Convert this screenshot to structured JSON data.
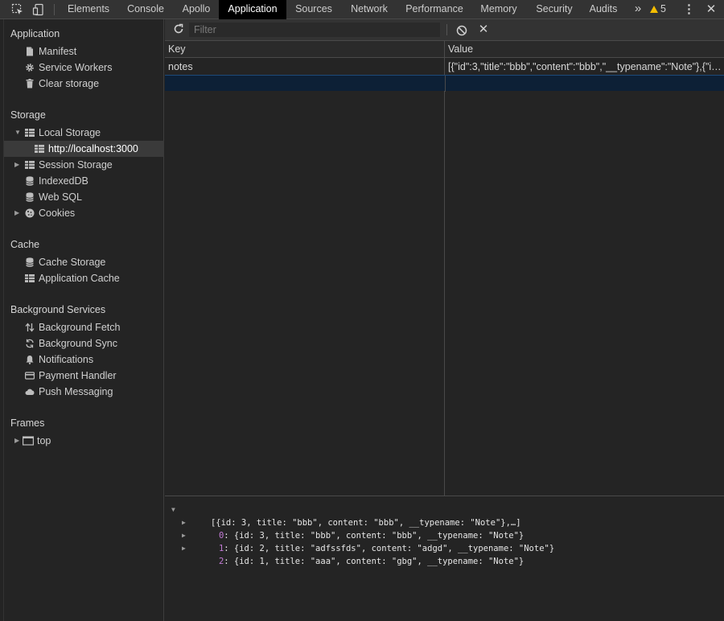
{
  "topbar": {
    "tabs": [
      "Elements",
      "Console",
      "Apollo",
      "Application",
      "Sources",
      "Network",
      "Performance",
      "Memory",
      "Security",
      "Audits"
    ],
    "active_tab": "Application",
    "overflow": "»",
    "warnings_count": "5",
    "more": "⋮",
    "close": "✕"
  },
  "sidebar": {
    "sections": {
      "application": "Application",
      "storage": "Storage",
      "cache": "Cache",
      "background": "Background Services",
      "frames": "Frames"
    },
    "application_items": [
      "Manifest",
      "Service Workers",
      "Clear storage"
    ],
    "storage_items": [
      "Local Storage",
      "http://localhost:3000",
      "Session Storage",
      "IndexedDB",
      "Web SQL",
      "Cookies"
    ],
    "cache_items": [
      "Cache Storage",
      "Application Cache"
    ],
    "background_items": [
      "Background Fetch",
      "Background Sync",
      "Notifications",
      "Payment Handler",
      "Push Messaging"
    ],
    "frames_items": [
      "top"
    ]
  },
  "toolbar": {
    "filter_placeholder": "Filter"
  },
  "table": {
    "headers": {
      "key": "Key",
      "value": "Value"
    },
    "rows": [
      {
        "key": "notes",
        "value": "[{\"id\":3,\"title\":\"bbb\",\"content\":\"bbb\",\"__typename\":\"Note\"},{\"id\":2,\"title\":\"adfssfds\",\"content\":\"adgd\",\"__typename\":\"Note\"},{\"id\":1,\"title\":\"aaa\",\"content\":\"gbg\",\"__typename\":\"Note\"}]"
      }
    ]
  },
  "preview": {
    "summary": "[{id: 3, title: \"bbb\", content: \"bbb\", __typename: \"Note\"},…]",
    "items": [
      {
        "index": "0",
        "text": ": {id: 3, title: \"bbb\", content: \"bbb\", __typename: \"Note\"}"
      },
      {
        "index": "1",
        "text": ": {id: 2, title: \"adfssfds\", content: \"adgd\", __typename: \"Note\"}"
      },
      {
        "index": "2",
        "text": ": {id: 1, title: \"aaa\", content: \"gbg\", __typename: \"Note\"}"
      }
    ]
  },
  "colors": {
    "accent_warning": "#f4bd00",
    "active_tab_bg": "#000000",
    "selected_row_bg": "#0d2036",
    "preview_index": "#c37bd6"
  }
}
